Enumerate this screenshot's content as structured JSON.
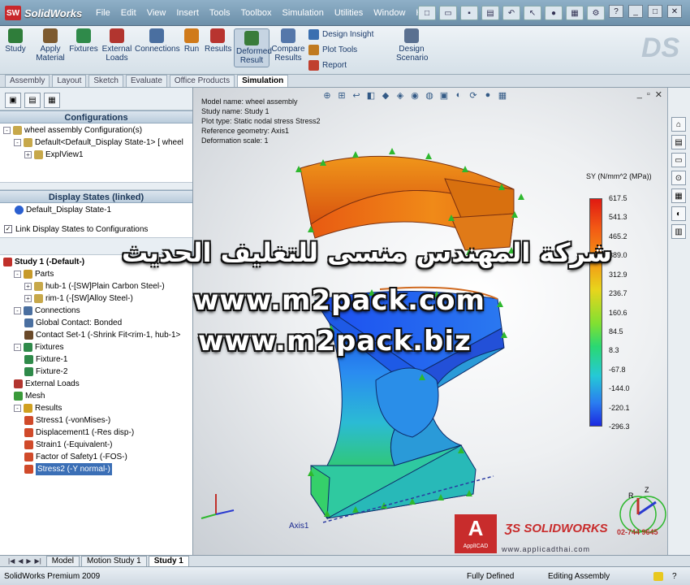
{
  "app": {
    "title": "SolidWorks",
    "logo_text": "SW"
  },
  "menu": [
    "File",
    "Edit",
    "View",
    "Insert",
    "Tools",
    "Toolbox",
    "Simulation",
    "Utilities",
    "Window",
    "Help"
  ],
  "ribbon": {
    "buttons": [
      {
        "id": "study",
        "label": "Study",
        "color": "#2f7d3a"
      },
      {
        "id": "apply-material",
        "label": "Apply Material",
        "color": "#7d5a2f"
      },
      {
        "id": "fixtures",
        "label": "Fixtures",
        "color": "#2f8a4a"
      },
      {
        "id": "external-loads",
        "label": "External Loads",
        "color": "#b2352f"
      },
      {
        "id": "connections",
        "label": "Connections",
        "color": "#4a6fa0"
      },
      {
        "id": "run",
        "label": "Run",
        "color": "#d07a1a"
      },
      {
        "id": "results",
        "label": "Results",
        "color": "#b8342f"
      },
      {
        "id": "deformed-result",
        "label": "Deformed Result",
        "color": "#3a7c3a"
      },
      {
        "id": "compare-results",
        "label": "Compare Results",
        "color": "#5577aa"
      },
      {
        "id": "design-scenario",
        "label": "Design Scenario",
        "color": "#5a7090"
      }
    ],
    "small": [
      {
        "label": "Design Insight",
        "color": "#3a6fb0"
      },
      {
        "label": "Plot Tools",
        "color": "#c07a20"
      },
      {
        "label": "Report",
        "color": "#c0402f"
      }
    ]
  },
  "cmd_tabs": [
    "Assembly",
    "Layout",
    "Sketch",
    "Evaluate",
    "Office Products",
    "Simulation"
  ],
  "active_cmd_tab": "Simulation",
  "configurations": {
    "header": "Configurations",
    "rows": [
      {
        "text": "wheel assembly Configuration(s)",
        "indent": 0,
        "pm": "-"
      },
      {
        "text": "Default<Default_Display State-1> [ wheel",
        "indent": 1,
        "pm": "-"
      },
      {
        "text": "ExplView1",
        "indent": 2,
        "pm": "+"
      }
    ]
  },
  "display_states": {
    "header": "Display States (linked)",
    "rows": [
      "Default_Display State-1"
    ],
    "link_label": "Link Display States to Configurations"
  },
  "study_tree": [
    {
      "text": "Study 1 (-Default-)",
      "indent": 0,
      "pm": "",
      "bold": true,
      "color": "#c0302a"
    },
    {
      "text": "Parts",
      "indent": 1,
      "pm": "-",
      "color": "#c79a2a"
    },
    {
      "text": "hub-1 (-[SW]Plain Carbon Steel-)",
      "indent": 2,
      "pm": "+",
      "color": "#c7a84a"
    },
    {
      "text": "rim-1 (-[SW]Alloy Steel-)",
      "indent": 2,
      "pm": "+",
      "color": "#c7a84a"
    },
    {
      "text": "Connections",
      "indent": 1,
      "pm": "-",
      "color": "#4a6fa0"
    },
    {
      "text": "Global Contact: Bonded",
      "indent": 2,
      "pm": "",
      "color": "#4a6fa0"
    },
    {
      "text": "Contact Set-1 (-Shrink Fit<rim-1, hub-1>",
      "indent": 2,
      "pm": "",
      "color": "#6a4a2a"
    },
    {
      "text": "Fixtures",
      "indent": 1,
      "pm": "-",
      "color": "#2f8a4a"
    },
    {
      "text": "Fixture-1",
      "indent": 2,
      "pm": "",
      "color": "#2f8a4a"
    },
    {
      "text": "Fixture-2",
      "indent": 2,
      "pm": "",
      "color": "#2f8a4a"
    },
    {
      "text": "External Loads",
      "indent": 1,
      "pm": "",
      "color": "#b2352f"
    },
    {
      "text": "Mesh",
      "indent": 1,
      "pm": "",
      "color": "#3a9a3a"
    },
    {
      "text": "Results",
      "indent": 1,
      "pm": "-",
      "color": "#d0a020"
    },
    {
      "text": "Stress1 (-vonMises-)",
      "indent": 2,
      "pm": "",
      "color": "#d04a2a"
    },
    {
      "text": "Displacement1 (-Res disp-)",
      "indent": 2,
      "pm": "",
      "color": "#d04a2a"
    },
    {
      "text": "Strain1 (-Equivalent-)",
      "indent": 2,
      "pm": "",
      "color": "#d04a2a"
    },
    {
      "text": "Factor of Safety1 (-FOS-)",
      "indent": 2,
      "pm": "",
      "color": "#d04a2a"
    },
    {
      "text": "Stress2 (-Y normal-)",
      "indent": 2,
      "pm": "",
      "color": "#d04a2a",
      "selected": true
    }
  ],
  "plot_info": [
    "Model name: wheel assembly",
    "Study name: Study 1",
    "Plot type: Static nodal stress Stress2",
    "Reference geometry: Axis1",
    "Deformation scale: 1"
  ],
  "legend": {
    "title": "SY (N/mm^2 (MPa))",
    "values": [
      "617.5",
      "541.3",
      "465.2",
      "389.0",
      "312.9",
      "236.7",
      "160.6",
      "84.5",
      "8.3",
      "-67.8",
      "-144.0",
      "-220.1",
      "-296.3"
    ]
  },
  "axis_label": "Axis1",
  "triad_labels": {
    "r": "R",
    "z": "Z"
  },
  "watermark": {
    "arabic": "شركة المهندس منسى للتغليف الحديث",
    "url1": "www.m2pack.com",
    "url2": "www.m2pack.biz"
  },
  "brand": {
    "appli": "ApplICAD",
    "solidworks": "SOLIDWORKS",
    "phone": "02-744 9645",
    "url": "www.applicadthai.com"
  },
  "bottom_tabs": [
    "Model",
    "Motion Study 1",
    "Study 1"
  ],
  "active_bottom_tab": "Study 1",
  "status": {
    "left": "SolidWorks Premium 2009",
    "fully_defined": "Fully Defined",
    "editing": "Editing Assembly",
    "help": "?"
  }
}
